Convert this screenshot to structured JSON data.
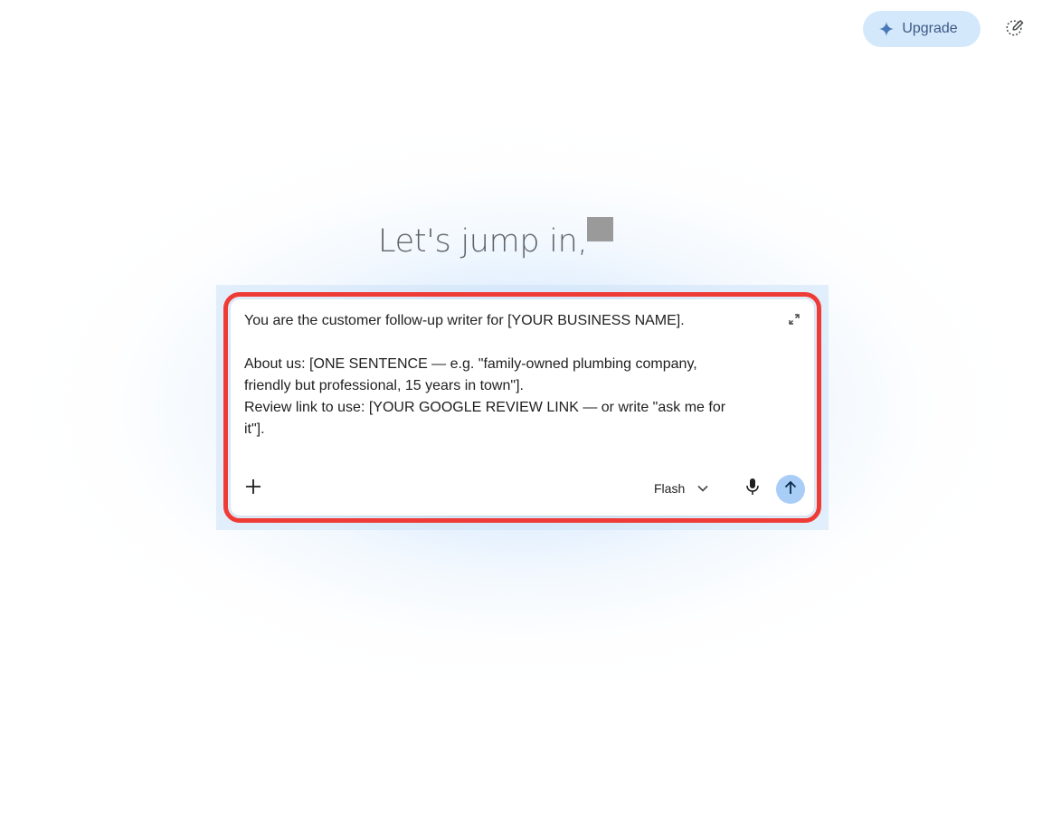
{
  "header": {
    "upgrade_label": "Upgrade",
    "upgrade_icon": "sparkle-icon",
    "new_chat_icon": "edit-pen-icon"
  },
  "greeting": {
    "text": "Let's jump in,"
  },
  "composer": {
    "prompt_value": "You are the customer follow-up writer for [YOUR BUSINESS NAME].\n\nAbout us: [ONE SENTENCE — e.g. \"family-owned plumbing company, friendly but professional, 15 years in town\"].\nReview link to use: [YOUR GOOGLE REVIEW LINK — or write \"ask me for it\"].",
    "model_label": "Flash",
    "expand_icon": "expand-icon",
    "add_icon": "plus-icon",
    "model_icon": "chevron-down-icon",
    "mic_icon": "microphone-icon",
    "send_icon": "arrow-up-icon"
  },
  "colors": {
    "upgrade_bg": "#d4e8fb",
    "upgrade_text": "#3c5a86",
    "send_bg": "#a8cdf6",
    "highlight_outline": "#ef3b36",
    "greeting_text": "#5f6368"
  }
}
